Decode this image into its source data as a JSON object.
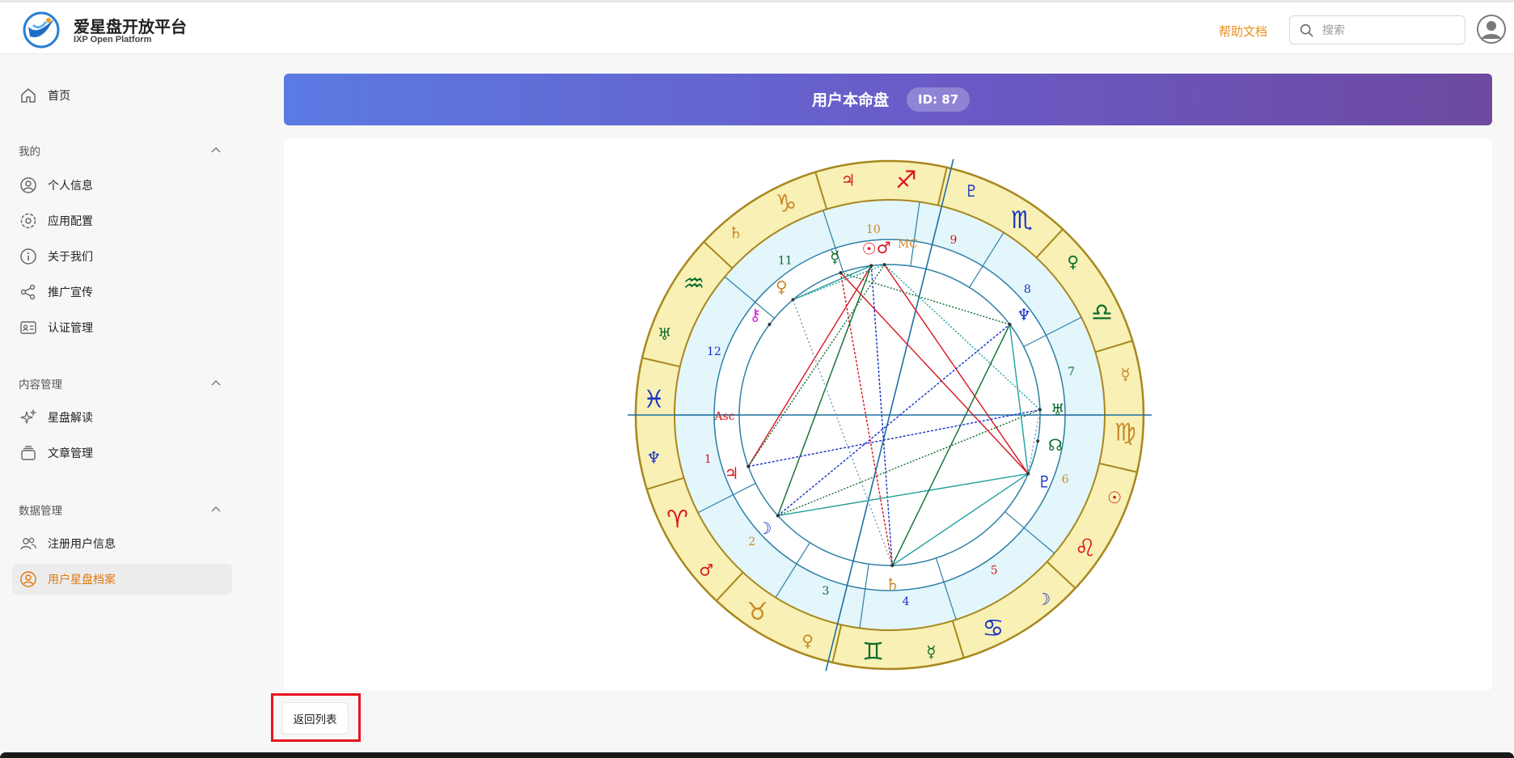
{
  "app": {
    "title": "爱星盘开放平台",
    "subtitle": "IXP Open Platform"
  },
  "header": {
    "help_link": "帮助文档",
    "search_placeholder": "搜索"
  },
  "sidebar": {
    "home": "首页",
    "groups": [
      {
        "label": "我的",
        "items": [
          "个人信息",
          "应用配置",
          "关于我们",
          "推广宣传",
          "认证管理"
        ]
      },
      {
        "label": "内容管理",
        "items": [
          "星盘解读",
          "文章管理"
        ]
      },
      {
        "label": "数据管理",
        "items": [
          "注册用户信息",
          "用户星盘档案"
        ]
      }
    ],
    "active_item": "用户星盘档案"
  },
  "page": {
    "title": "用户本命盘",
    "id_badge": "ID: 87",
    "back_button": "返回列表"
  },
  "chart": {
    "house_numbers": [
      "1",
      "2",
      "3",
      "4",
      "5",
      "6",
      "7",
      "8",
      "9",
      "10",
      "11",
      "12"
    ],
    "angle_labels": {
      "ascendant": "Asc",
      "midheaven": "MC"
    },
    "signs": [
      "♈",
      "♉",
      "♊",
      "♋",
      "♌",
      "♍",
      "♎",
      "♏",
      "♐",
      "♑",
      "♒",
      "♓"
    ],
    "rulers": [
      "♂",
      "♀",
      "☿",
      "☽",
      "☉",
      "☿",
      "♀",
      "♇",
      "♃",
      "♄",
      "♅",
      "♆"
    ],
    "planets": [
      "☉",
      "☽",
      "☿",
      "♀",
      "♂",
      "♃",
      "♄",
      "♅",
      "♆",
      "♇",
      "☊",
      "⚷"
    ]
  },
  "colors": {
    "accent": "#e07b12",
    "banner_start": "#5b7ae3",
    "banner_end": "#6d4aa0",
    "zodiac_ring": "#f8f0b4",
    "house_ring": "#e3f6fb",
    "fire": "#d9141f",
    "earth": "#c8892a",
    "air": "#0c6b2e",
    "water": "#1530c8",
    "highlight": "#e8141f"
  }
}
